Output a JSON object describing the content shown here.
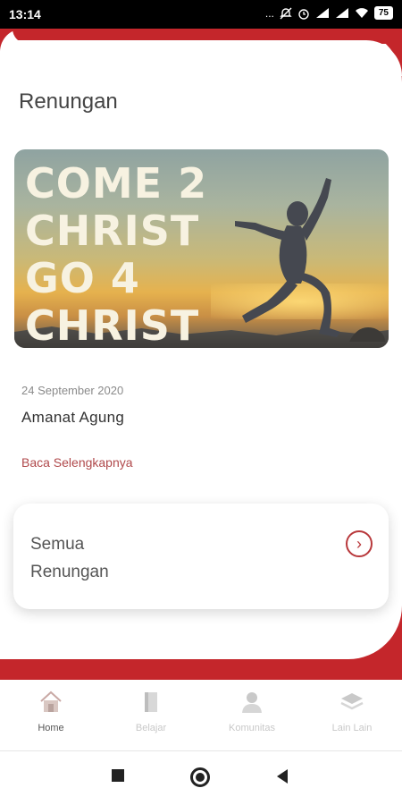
{
  "status_bar": {
    "time": "13:14",
    "icons": [
      "dots-icon",
      "mute-icon",
      "alarm-icon",
      "signal-icon",
      "signal-icon",
      "wifi-icon"
    ],
    "dots": "...",
    "battery": "75"
  },
  "page": {
    "title": "Renungan"
  },
  "banner": {
    "lines": [
      "COME 2",
      "CHRIST",
      "GO 4",
      "CHRIST"
    ]
  },
  "post": {
    "date": "24 September 2020",
    "title": "Amanat Agung",
    "read_more": "Baca Selengkapnya"
  },
  "all_devotions": {
    "label_line1": "Semua",
    "label_line2": "Renungan",
    "arrow": "›"
  },
  "bottom_nav": {
    "items": [
      {
        "label": "Home",
        "icon": "home-icon",
        "active": true
      },
      {
        "label": "Belajar",
        "icon": "book-icon",
        "active": false
      },
      {
        "label": "Komunitas",
        "icon": "person-icon",
        "active": false
      },
      {
        "label": "Lain Lain",
        "icon": "layers-icon",
        "active": false
      }
    ]
  },
  "colors": {
    "accent": "#c4262b",
    "link": "#b0494b"
  }
}
